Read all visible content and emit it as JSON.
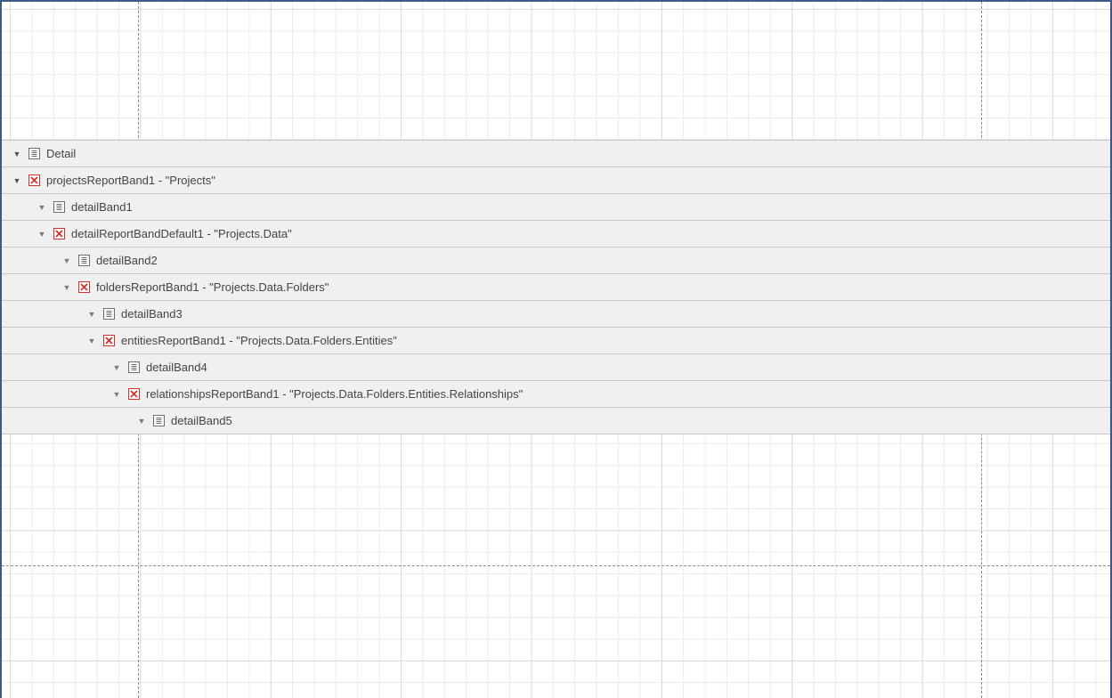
{
  "bands": [
    {
      "label": "Detail",
      "icon": "detail-band-icon",
      "level": 0
    },
    {
      "label": "projectsReportBand1 - \"Projects\"",
      "icon": "report-band-x-icon",
      "level": 0
    },
    {
      "label": "detailBand1",
      "icon": "detail-band-icon",
      "level": 1
    },
    {
      "label": "detailReportBandDefault1 - \"Projects.Data\"",
      "icon": "report-band-x-icon",
      "level": 1
    },
    {
      "label": "detailBand2",
      "icon": "detail-band-icon",
      "level": 2
    },
    {
      "label": "foldersReportBand1 - \"Projects.Data.Folders\"",
      "icon": "report-band-x-icon",
      "level": 2
    },
    {
      "label": "detailBand3",
      "icon": "detail-band-icon",
      "level": 3
    },
    {
      "label": "entitiesReportBand1 - \"Projects.Data.Folders.Entities\"",
      "icon": "report-band-x-icon",
      "level": 3
    },
    {
      "label": "detailBand4",
      "icon": "detail-band-icon",
      "level": 4
    },
    {
      "label": "relationshipsReportBand1 - \"Projects.Data.Folders.Entities.Relationships\"",
      "icon": "report-band-x-icon",
      "level": 4
    },
    {
      "label": "detailBand5",
      "icon": "detail-band-icon",
      "level": 5
    }
  ],
  "colors": {
    "frame_border": "#3c5a86",
    "band_background": "#f0f0f0",
    "report_band_icon": "#d32f2f",
    "text": "#444444"
  }
}
